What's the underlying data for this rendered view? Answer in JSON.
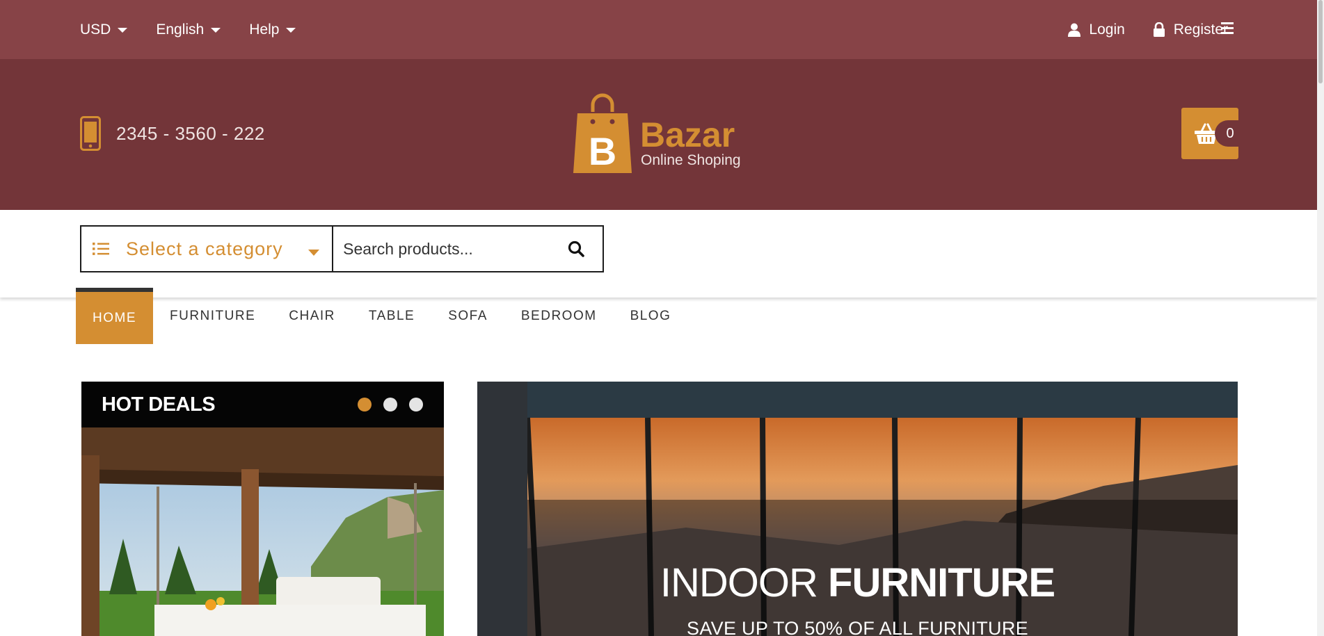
{
  "topbar": {
    "currency": "USD",
    "language": "English",
    "help": "Help",
    "login": "Login",
    "register": "Register"
  },
  "header": {
    "phone": "2345 - 3560 - 222",
    "logo_letter": "B",
    "logo_name": "Bazar",
    "logo_tagline": "Online Shoping",
    "cart_count": "0"
  },
  "search": {
    "category_label": "Select a category",
    "placeholder": "Search products..."
  },
  "nav": {
    "items": [
      {
        "label": "HOME",
        "active": true
      },
      {
        "label": "FURNITURE"
      },
      {
        "label": "CHAIR"
      },
      {
        "label": "TABLE"
      },
      {
        "label": "SOFA"
      },
      {
        "label": "BEDROOM"
      },
      {
        "label": "BLOG"
      }
    ]
  },
  "deals": {
    "title": "HOT DEALS",
    "active_slide": 1,
    "slide_count": 3
  },
  "hero": {
    "title_light": "INDOOR ",
    "title_bold": "FURNITURE",
    "subtitle": "SAVE UP TO 50% OF ALL FURNITURE"
  },
  "colors": {
    "topbar": "#874347",
    "header": "#733539",
    "accent": "#d48e32"
  },
  "icons": [
    "caret-down-icon",
    "user-icon",
    "lock-icon",
    "hamburger-icon",
    "phone-icon",
    "basket-icon",
    "list-icon",
    "search-icon"
  ]
}
